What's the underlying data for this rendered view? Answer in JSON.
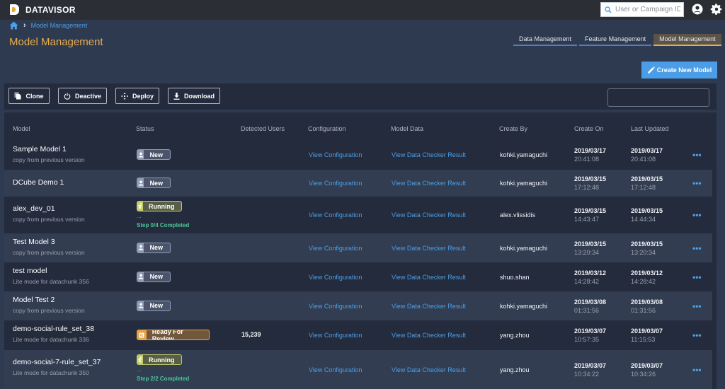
{
  "app": {
    "brand": "DATAVISOR",
    "global_search_placeholder": "User or Campaign ID"
  },
  "breadcrumb": {
    "separator": "›",
    "items": [
      "Model Management"
    ]
  },
  "page_title": "Model Management",
  "tabs": [
    {
      "label": "Data Management",
      "active": false
    },
    {
      "label": "Feature Management",
      "active": false
    },
    {
      "label": "Model Management",
      "active": true
    }
  ],
  "create_button": "Create New Model",
  "toolbar": {
    "clone": "Clone",
    "deactive": "Deactive",
    "deploy": "Deploy",
    "download": "Download",
    "search_value": ""
  },
  "table": {
    "columns": [
      "Model",
      "Status",
      "Detected Users",
      "Configuration",
      "Model Data",
      "Create By",
      "Create On",
      "Last Updated"
    ],
    "rows": [
      {
        "name": "Sample Model 1",
        "desc": "copy from previous version",
        "status": "New",
        "status_type": "new",
        "step": "",
        "detected": "",
        "config": "View Configuration",
        "data": "View Data Checker Result",
        "creator": "kohki.yamaguchi",
        "created_date": "2019/03/17",
        "created_time": "20:41:08",
        "updated_date": "2019/03/17",
        "updated_time": "20:41:08",
        "more": "•••"
      },
      {
        "name": "DCube Demo 1",
        "desc": "",
        "status": "New",
        "status_type": "new",
        "step": "",
        "detected": "",
        "config": "View Configuration",
        "data": "View Data Checker Result",
        "creator": "kohki.yamaguchi",
        "created_date": "2019/03/15",
        "created_time": "17:12:48",
        "updated_date": "2019/03/15",
        "updated_time": "17:12:48",
        "more": "•••"
      },
      {
        "name": "alex_dev_01",
        "desc": "copy from previous version",
        "status": "Running",
        "status_type": "run",
        "step": "Step 0/4 Completed",
        "detected": "",
        "config": "View Configuration",
        "data": "View Data Checker Result",
        "creator": "alex.vlissidis",
        "created_date": "2019/03/15",
        "created_time": "14:43:47",
        "updated_date": "2019/03/15",
        "updated_time": "14:44:34",
        "more": "•••"
      },
      {
        "name": "Test Model 3",
        "desc": "copy from previous version",
        "status": "New",
        "status_type": "new",
        "step": "",
        "detected": "",
        "config": "View Configuration",
        "data": "View Data Checker Result",
        "creator": "kohki.yamaguchi",
        "created_date": "2019/03/15",
        "created_time": "13:20:34",
        "updated_date": "2019/03/15",
        "updated_time": "13:20:34",
        "more": "•••"
      },
      {
        "name": "test model",
        "desc": "Lite mode for datachunk 356",
        "status": "New",
        "status_type": "new",
        "step": "",
        "detected": "",
        "config": "View Configuration",
        "data": "View Data Checker Result",
        "creator": "shuo.shan",
        "created_date": "2019/03/12",
        "created_time": "14:28:42",
        "updated_date": "2019/03/12",
        "updated_time": "14:28:42",
        "more": "•••"
      },
      {
        "name": "Model Test 2",
        "desc": "copy from previous version",
        "status": "New",
        "status_type": "new",
        "step": "",
        "detected": "",
        "config": "View Configuration",
        "data": "View Data Checker Result",
        "creator": "kohki.yamaguchi",
        "created_date": "2019/03/08",
        "created_time": "01:31:56",
        "updated_date": "2019/03/08",
        "updated_time": "01:31:56",
        "more": "•••"
      },
      {
        "name": "demo-social-rule_set_38",
        "desc": "Lite mode for datachunk 336",
        "status": "Ready For Review",
        "status_type": "review",
        "step": "",
        "detected": "15,239",
        "config": "View Configuration",
        "data": "View Data Checker Result",
        "creator": "yang.zhou",
        "created_date": "2019/03/07",
        "created_time": "10:57:35",
        "updated_date": "2019/03/07",
        "updated_time": "11:15:53",
        "more": "•••"
      },
      {
        "name": "demo-social-7-rule_set_37",
        "desc": "Lite mode for datachunk 350",
        "status": "Running",
        "status_type": "run",
        "step": "Step 2/2 Completed",
        "detected": "",
        "config": "View Configuration",
        "data": "View Data Checker Result",
        "creator": "yang.zhou",
        "created_date": "2019/03/07",
        "created_time": "10:34:22",
        "updated_date": "2019/03/07",
        "updated_time": "10:34:26",
        "more": "•••"
      }
    ]
  },
  "colors": {
    "accent_title": "#e9ad4c",
    "link": "#4b9fe6",
    "primary_button": "#4a9de6",
    "step_text": "#4ec59a"
  }
}
